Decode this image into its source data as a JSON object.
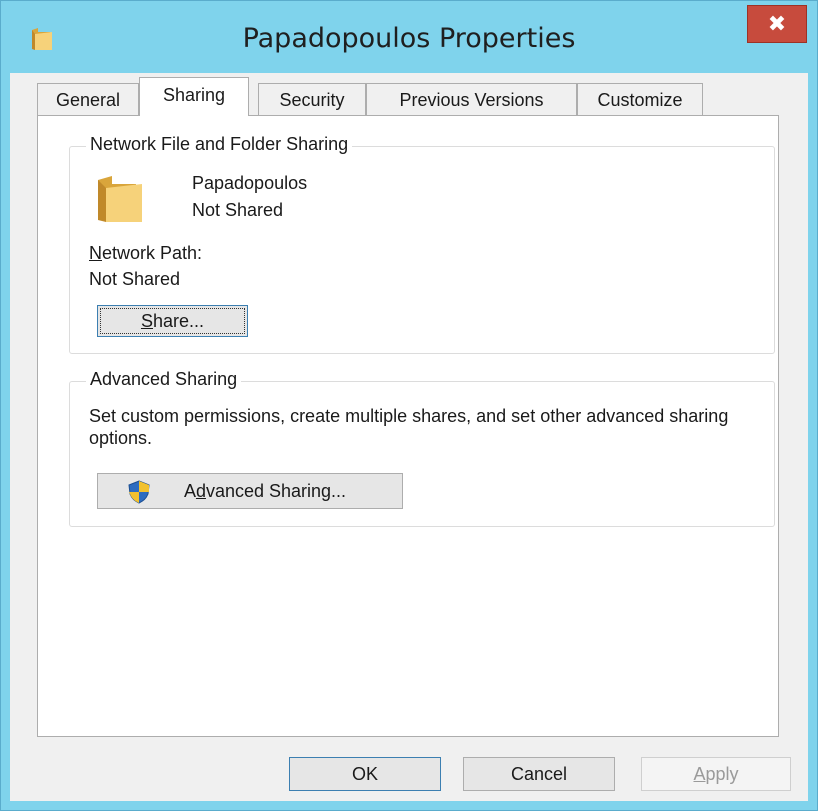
{
  "window": {
    "title": "Papadopoulos Properties",
    "close_glyph": "✖",
    "icon": "folder-icon",
    "accent": "#7fd3ec",
    "close_color": "#c74b3d"
  },
  "tabs": [
    {
      "label": "General",
      "active": false
    },
    {
      "label": "Sharing",
      "active": true
    },
    {
      "label": "Security",
      "active": false
    },
    {
      "label": "Previous Versions",
      "active": false
    },
    {
      "label": "Customize",
      "active": false
    }
  ],
  "network_sharing": {
    "group_title": "Network File and Folder Sharing",
    "folder_name": "Papadopoulos",
    "folder_status": "Not Shared",
    "network_path_label": {
      "mnemonic": "N",
      "rest": "etwork Path:"
    },
    "network_path_value": "Not Shared",
    "share_button": {
      "mnemonic": "S",
      "rest": "hare..."
    }
  },
  "advanced_sharing": {
    "group_title": "Advanced Sharing",
    "description": "Set custom permissions, create multiple shares, and set other advanced sharing options.",
    "button": {
      "prefix": "A",
      "mnemonic": "d",
      "rest": "vanced Sharing..."
    }
  },
  "footer": {
    "ok": "OK",
    "cancel": "Cancel",
    "apply": {
      "mnemonic": "A",
      "rest": "pply",
      "enabled": false
    }
  }
}
